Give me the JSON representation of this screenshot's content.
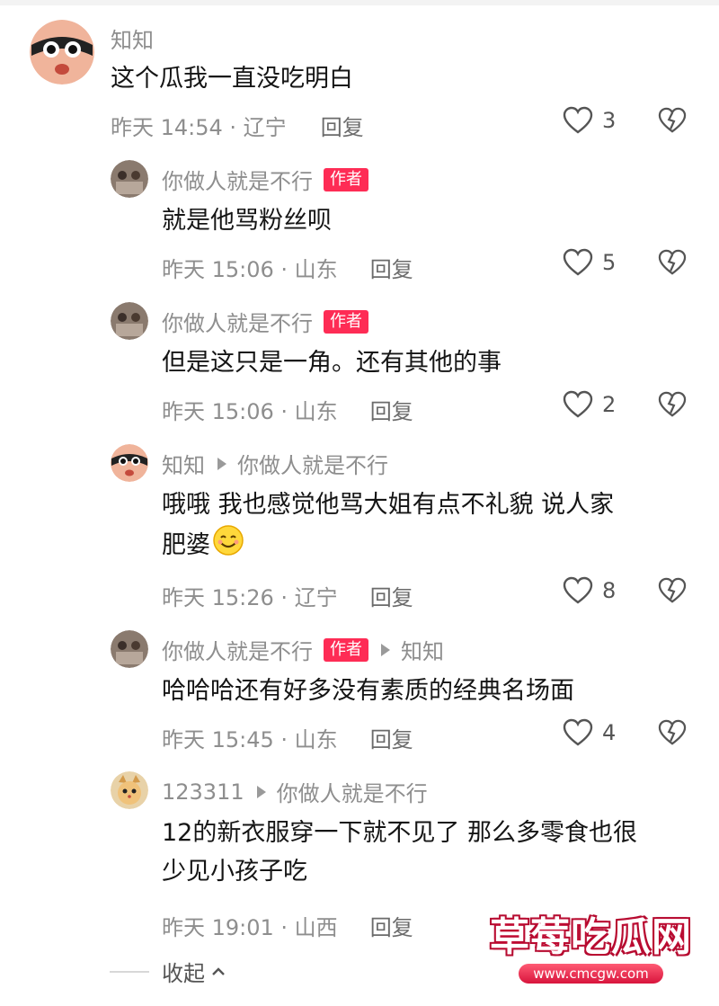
{
  "comments": [
    {
      "username": "知知",
      "text": "这个瓜我一直没吃明白",
      "time": "昨天 14:54 · 辽宁",
      "reply": "回复",
      "likes": "3",
      "avatar": "cartoon-face-avatar"
    },
    {
      "username": "你做人就是不行",
      "author_tag": "作者",
      "text": "就是他骂粉丝呗",
      "time": "昨天 15:06 · 山东",
      "reply": "回复",
      "likes": "5",
      "avatar": "group-photo-avatar"
    },
    {
      "username": "你做人就是不行",
      "author_tag": "作者",
      "text": "但是这只是一角。还有其他的事",
      "time": "昨天 15:06 · 山东",
      "reply": "回复",
      "likes": "2",
      "avatar": "group-photo-avatar"
    },
    {
      "username": "知知",
      "reply_to": "你做人就是不行",
      "text": "哦哦 我也感觉他骂大姐有点不礼貌 说人家\n肥婆",
      "time": "昨天 15:26 · 辽宁",
      "reply": "回复",
      "likes": "8",
      "avatar": "cartoon-face-avatar"
    },
    {
      "username": "你做人就是不行",
      "author_tag": "作者",
      "reply_to": "知知",
      "text": "哈哈哈还有好多没有素质的经典名场面",
      "time": "昨天 15:45 · 山东",
      "reply": "回复",
      "likes": "4",
      "avatar": "group-photo-avatar"
    },
    {
      "username": "123311",
      "reply_to": "你做人就是不行",
      "text": "12的新衣服穿一下就不见了 那么多零食也很\n少见小孩子吃",
      "time": "昨天 19:01 · 山西",
      "reply": "回复",
      "avatar": "cat-avatar"
    }
  ],
  "collapse_label": "收起",
  "watermark": {
    "title": "草莓吃瓜网",
    "url": "www.cmcgw.com"
  },
  "colors": {
    "author_tag": "#fe2c55",
    "meta": "#8e8e8e",
    "text": "#151515"
  },
  "icons": [
    "heart-icon",
    "broken-heart-icon",
    "play-arrow-icon",
    "chevron-up-icon",
    "smile-emoji-icon"
  ]
}
